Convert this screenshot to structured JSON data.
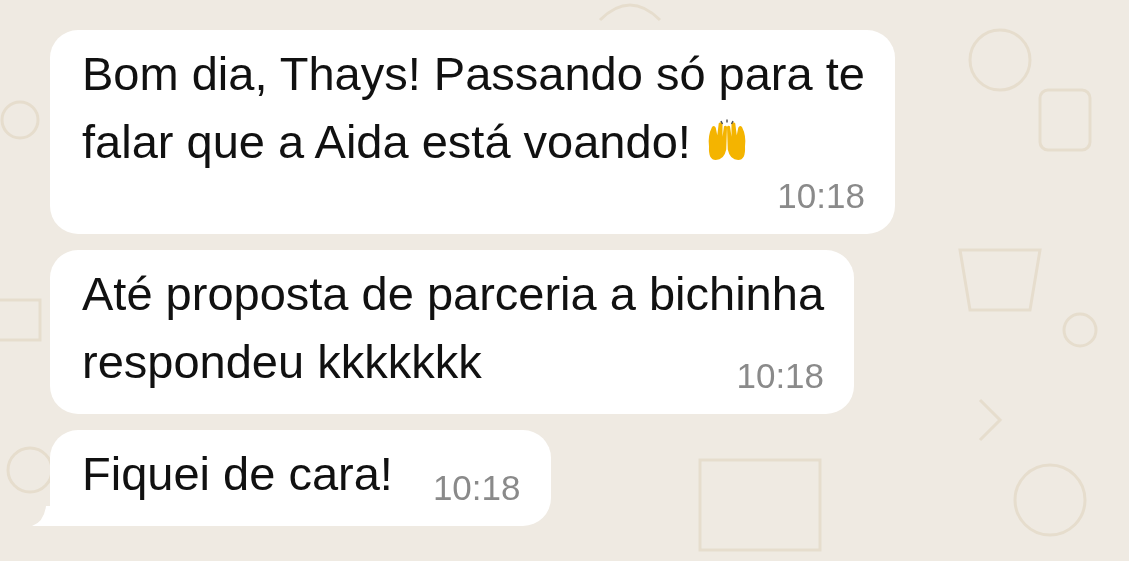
{
  "messages": [
    {
      "lines": [
        "Bom dia, Thays! Passando só para te",
        "falar que a Aida está voando!"
      ],
      "emoji": true,
      "time": "10:18",
      "tail": false
    },
    {
      "lines": [
        "Até proposta de parceria a bichinha",
        "respondeu kkkkkkk"
      ],
      "emoji": false,
      "time": "10:18",
      "tail": false
    },
    {
      "lines": [
        "Fiquei de cara!"
      ],
      "emoji": false,
      "time": "10:18",
      "tail": true
    }
  ]
}
